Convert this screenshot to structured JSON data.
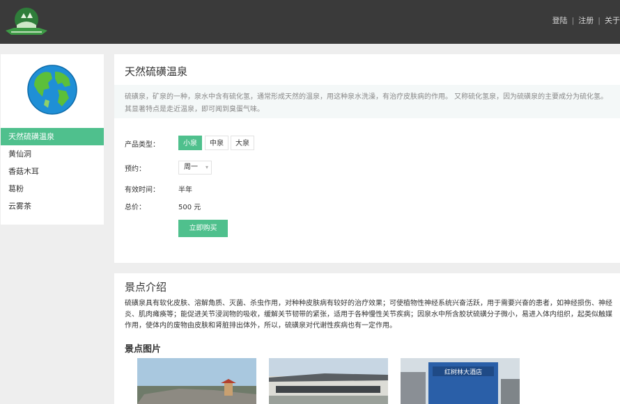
{
  "header": {
    "logo_icon": "hot-spring-logo-icon",
    "nav": [
      "登陆",
      "注册",
      "关于"
    ],
    "separator": "|"
  },
  "sidebar": {
    "avatar_icon": "globe-icon",
    "items": [
      {
        "label": "天然硫磺温泉",
        "active": true
      },
      {
        "label": "黄仙洞",
        "active": false
      },
      {
        "label": "香菇木耳",
        "active": false
      },
      {
        "label": "葛粉",
        "active": false
      },
      {
        "label": "云雾茶",
        "active": false
      }
    ]
  },
  "product": {
    "title": "天然硫磺温泉",
    "description": "硫磺泉，矿泉的一种，泉水中含有硫化氢，通常形成天然的温泉，用这种泉水洗澡，有治疗皮肤病的作用。 又称硫化氢泉，因为硫磺泉的主要成分为硫化氢。其显著特点是走近温泉，即可闻到臭蛋气味。",
    "type_label": "产品类型：",
    "types": [
      "小泉",
      "中泉",
      "大泉"
    ],
    "selected_type": "小泉",
    "booking_label": "预约：",
    "booking_value": "周一",
    "validity_label": "有效时间：",
    "validity_value": "半年",
    "total_label": "总价：",
    "total_value": "500 元",
    "buy_label": "立即购买",
    "accent_color": "#4fc08d"
  },
  "intro": {
    "title": "景点介绍",
    "text": "硫磺泉具有软化皮肤、溶解角质、灭菌、杀虫作用，对种种皮肤病有较好的治疗效果；可使植物性神经系统兴奋活跃，用于需要兴奋的患者，如神经损伤、神经炎、肌肉瘫痪等；能促进关节浸润物的吸收，缓解关节韧带的紧张，适用于各种慢性关节疾病；因泉水中所含胶状硫磺分子微小，易进入体内组织，起类似触媒作用，使体内的废物由皮肤和肾脏排出体外，所以，硫磺泉对代谢性疾病也有一定作用。",
    "photos_title": "景点图片",
    "photo_sign": "红树林大酒店"
  }
}
